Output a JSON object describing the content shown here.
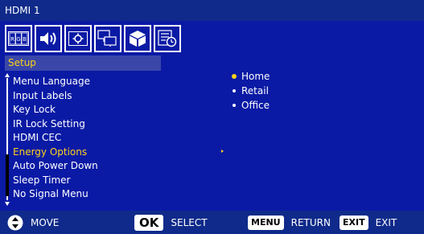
{
  "window": {
    "title": "HDMI 1"
  },
  "tabs": [
    {
      "icon": "picture-icon",
      "label": "RGB"
    },
    {
      "icon": "speaker-icon"
    },
    {
      "icon": "schedule-gear-icon"
    },
    {
      "icon": "setup-monitor-icon"
    },
    {
      "icon": "cube-icon"
    },
    {
      "icon": "list-clock-icon"
    }
  ],
  "section": {
    "title": "Setup"
  },
  "menu": {
    "items": [
      "Menu Language",
      "Input Labels",
      "Key Lock",
      "IR Lock Setting",
      "HDMI CEC",
      "Energy Options",
      "Auto Power Down",
      "Sleep Timer",
      "No Signal Menu"
    ],
    "active_index": 5
  },
  "options": {
    "items": [
      "Home",
      "Retail",
      "Office"
    ],
    "selected_index": 0
  },
  "footer": {
    "move_label": "MOVE",
    "ok_key": "OK",
    "ok_label": "SELECT",
    "menu_key": "MENU",
    "menu_label": "RETURN",
    "exit_key": "EXIT",
    "exit_label": "EXIT"
  },
  "colors": {
    "background": "#0a1aa5",
    "bar": "#0f2a8a",
    "highlight": "#ffd21a",
    "section": "#3a47a8"
  }
}
